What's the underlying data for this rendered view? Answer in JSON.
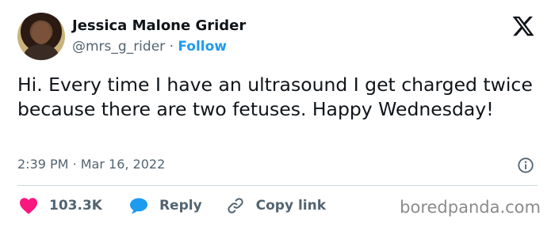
{
  "author": {
    "name": "Jessica Malone Grider",
    "handle": "@mrs_g_rider",
    "separator": "·",
    "follow_label": "Follow"
  },
  "tweet": {
    "text": "Hi. Every time I have an ultrasound I get charged twice because there are two fetuses. Happy Wednesday!",
    "time": "2:39 PM",
    "meta_separator": "·",
    "date": "Mar 16, 2022"
  },
  "actions": {
    "like_count": "103.3K",
    "reply_label": "Reply",
    "copy_link_label": "Copy link"
  },
  "watermark": "boredpanda.com",
  "colors": {
    "accent": "#1d9bf0",
    "like": "#f91880",
    "text": "#0f1419",
    "muted": "#536471",
    "divider": "#cfd9de"
  },
  "icons": [
    "avatar",
    "x-logo-icon",
    "info-icon",
    "heart-icon",
    "reply-bubble-icon",
    "link-icon"
  ]
}
